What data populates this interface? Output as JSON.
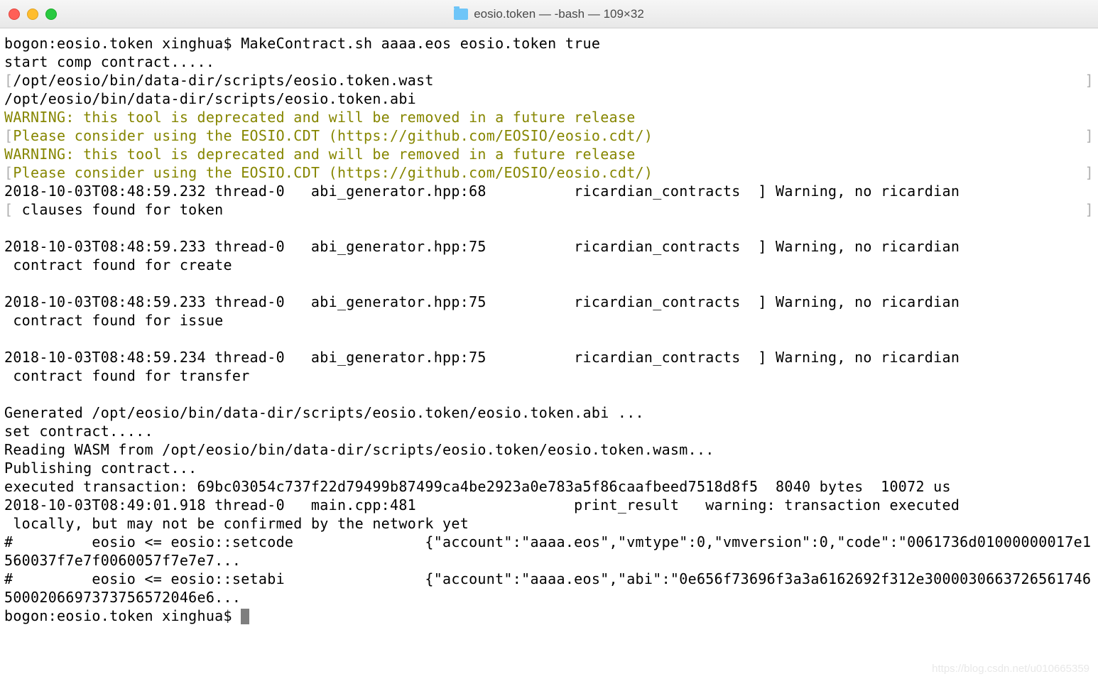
{
  "window": {
    "title": "eosio.token — -bash — 109×32"
  },
  "watermark": "https://blog.csdn.net/u010665359",
  "term": {
    "l1": "bogon:eosio.token xinghua$ MakeContract.sh aaaa.eos eosio.token true",
    "l2": "start comp contract.....",
    "l3a": "[",
    "l3b": "/opt/eosio/bin/data-dir/scripts/eosio.token.wast",
    "l3c": "]",
    "l4": "/opt/eosio/bin/data-dir/scripts/eosio.token.abi",
    "l5": "WARNING: this tool is deprecated and will be removed in a future release",
    "l6a": "[",
    "l6b": "Please consider using the EOSIO.CDT (https://github.com/EOSIO/eosio.cdt/)",
    "l6c": "]",
    "l7": "WARNING: this tool is deprecated and will be removed in a future release",
    "l8a": "[",
    "l8b": "Please consider using the EOSIO.CDT (https://github.com/EOSIO/eosio.cdt/)",
    "l8c": "]",
    "l9": "2018-10-03T08:48:59.232 thread-0   abi_generator.hpp:68          ricardian_contracts  ] Warning, no ricardian",
    "l10a": "[",
    "l10b": " clauses found for token",
    "l10c": "]",
    "l11": "",
    "l12": "2018-10-03T08:48:59.233 thread-0   abi_generator.hpp:75          ricardian_contracts  ] Warning, no ricardian",
    "l13": " contract found for create",
    "l14": "",
    "l15": "2018-10-03T08:48:59.233 thread-0   abi_generator.hpp:75          ricardian_contracts  ] Warning, no ricardian",
    "l16": " contract found for issue",
    "l17": "",
    "l18": "2018-10-03T08:48:59.234 thread-0   abi_generator.hpp:75          ricardian_contracts  ] Warning, no ricardian",
    "l19": " contract found for transfer",
    "l20": "",
    "l21": "Generated /opt/eosio/bin/data-dir/scripts/eosio.token/eosio.token.abi ...",
    "l22": "set contract.....",
    "l23": "Reading WASM from /opt/eosio/bin/data-dir/scripts/eosio.token/eosio.token.wasm...",
    "l24": "Publishing contract...",
    "l25": "executed transaction: 69bc03054c737f22d79499b87499ca4be2923a0e783a5f86caafbeed7518d8f5  8040 bytes  10072 us",
    "l26": "2018-10-03T08:49:01.918 thread-0   main.cpp:481                  print_result   warning: transaction executed",
    "l27": " locally, but may not be confirmed by the network yet",
    "l28": "#         eosio <= eosio::setcode               {\"account\":\"aaaa.eos\",\"vmtype\":0,\"vmversion\":0,\"code\":\"0061736d01000000017e1560037f7e7f0060057f7e7e7...",
    "l29": "#         eosio <= eosio::setabi                {\"account\":\"aaaa.eos\",\"abi\":\"0e656f73696f3a3a6162692f312e30000306637265617465000206697373756572046e6...",
    "l30": "bogon:eosio.token xinghua$ "
  }
}
